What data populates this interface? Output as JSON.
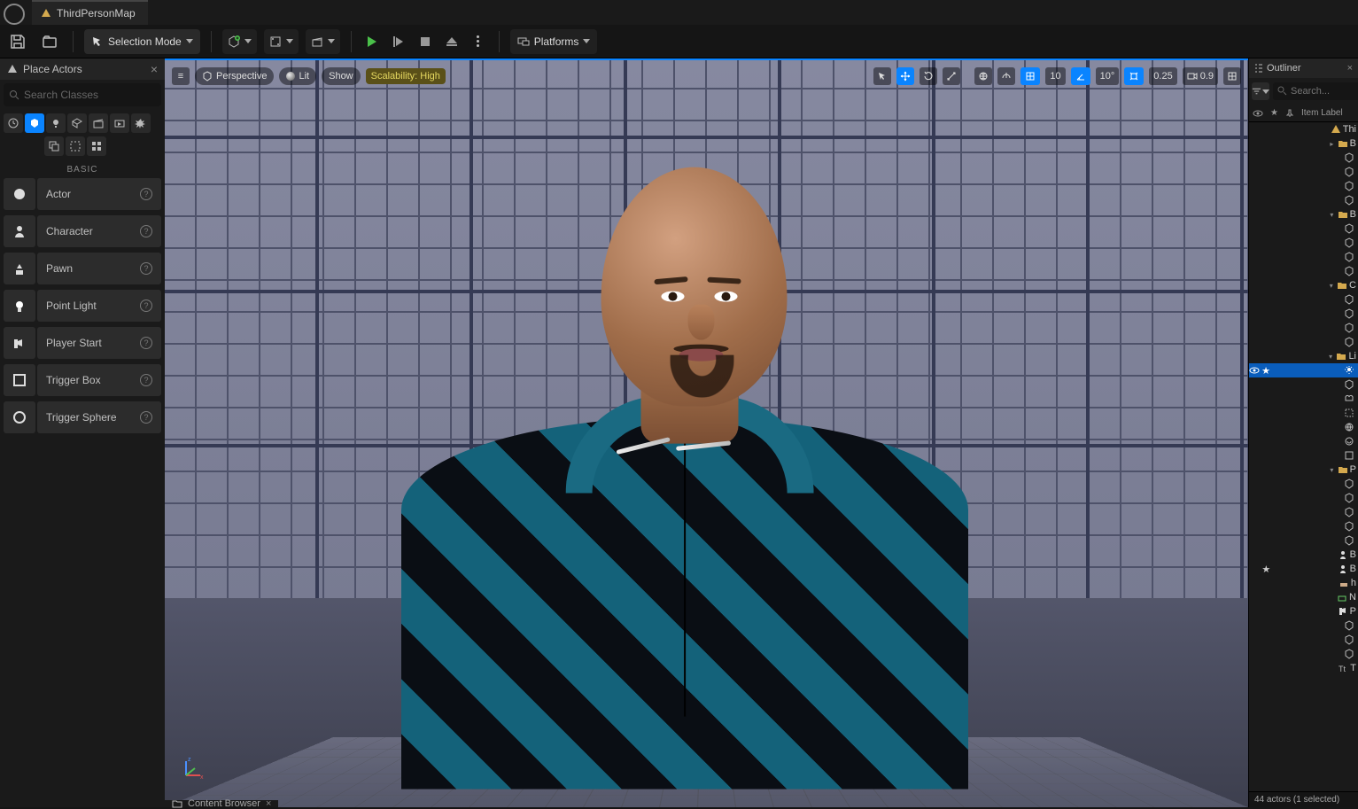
{
  "titlebar": {
    "tab_label": "ThirdPersonMap"
  },
  "toolbar": {
    "selection_mode": "Selection Mode",
    "platforms": "Platforms"
  },
  "left_panel": {
    "title": "Place Actors",
    "search_placeholder": "Search Classes",
    "section": "BASIC",
    "actors": [
      {
        "label": "Actor"
      },
      {
        "label": "Character"
      },
      {
        "label": "Pawn"
      },
      {
        "label": "Point Light"
      },
      {
        "label": "Player Start"
      },
      {
        "label": "Trigger Box"
      },
      {
        "label": "Trigger Sphere"
      }
    ]
  },
  "viewport": {
    "menu": "≡",
    "perspective": "Perspective",
    "lit": "Lit",
    "show": "Show",
    "scalability": "Scalability: High",
    "grid_snap": "10",
    "angle_snap": "10°",
    "scale_snap": "0.25",
    "camera_speed": "0.9"
  },
  "outliner": {
    "title": "Outliner",
    "search_placeholder": "Search...",
    "col_item": "Item Label",
    "status": "44 actors (1 selected)",
    "rows": [
      {
        "indent": 0,
        "icon": "level",
        "label": "Thi",
        "prefix": ""
      },
      {
        "indent": 1,
        "icon": "folder",
        "label": "B",
        "prefix": "▸"
      },
      {
        "indent": 2,
        "icon": "actor",
        "label": "",
        "prefix": ""
      },
      {
        "indent": 2,
        "icon": "actor",
        "label": "",
        "prefix": ""
      },
      {
        "indent": 2,
        "icon": "actor",
        "label": "",
        "prefix": ""
      },
      {
        "indent": 2,
        "icon": "actor",
        "label": "",
        "prefix": ""
      },
      {
        "indent": 1,
        "icon": "folder",
        "label": "B",
        "prefix": "▾"
      },
      {
        "indent": 2,
        "icon": "actor",
        "label": "",
        "prefix": ""
      },
      {
        "indent": 2,
        "icon": "actor",
        "label": "",
        "prefix": ""
      },
      {
        "indent": 2,
        "icon": "actor",
        "label": "",
        "prefix": ""
      },
      {
        "indent": 2,
        "icon": "actor",
        "label": "",
        "prefix": ""
      },
      {
        "indent": 1,
        "icon": "folder",
        "label": "C",
        "prefix": "▾"
      },
      {
        "indent": 2,
        "icon": "actor",
        "label": "",
        "prefix": ""
      },
      {
        "indent": 2,
        "icon": "actor",
        "label": "",
        "prefix": ""
      },
      {
        "indent": 2,
        "icon": "actor",
        "label": "",
        "prefix": ""
      },
      {
        "indent": 2,
        "icon": "actor",
        "label": "",
        "prefix": ""
      },
      {
        "indent": 1,
        "icon": "folder",
        "label": "Li",
        "prefix": "▾"
      },
      {
        "indent": 2,
        "icon": "light",
        "label": "",
        "prefix": "",
        "selected": true
      },
      {
        "indent": 2,
        "icon": "actor",
        "label": "",
        "prefix": ""
      },
      {
        "indent": 2,
        "icon": "fog",
        "label": "",
        "prefix": ""
      },
      {
        "indent": 2,
        "icon": "post",
        "label": "",
        "prefix": ""
      },
      {
        "indent": 2,
        "icon": "sky",
        "label": "",
        "prefix": ""
      },
      {
        "indent": 2,
        "icon": "skyl",
        "label": "",
        "prefix": ""
      },
      {
        "indent": 2,
        "icon": "vol",
        "label": "",
        "prefix": ""
      },
      {
        "indent": 1,
        "icon": "folder",
        "label": "P",
        "prefix": "▾"
      },
      {
        "indent": 2,
        "icon": "actor",
        "label": "",
        "prefix": ""
      },
      {
        "indent": 2,
        "icon": "actor",
        "label": "",
        "prefix": ""
      },
      {
        "indent": 2,
        "icon": "actor",
        "label": "",
        "prefix": ""
      },
      {
        "indent": 2,
        "icon": "actor",
        "label": "",
        "prefix": ""
      },
      {
        "indent": 2,
        "icon": "actor",
        "label": "",
        "prefix": ""
      },
      {
        "indent": 1,
        "icon": "char",
        "label": "B",
        "prefix": ""
      },
      {
        "indent": 1,
        "icon": "char",
        "label": "B",
        "prefix": "",
        "starred": true
      },
      {
        "indent": 1,
        "icon": "mesh",
        "label": "h",
        "prefix": ""
      },
      {
        "indent": 1,
        "icon": "nav",
        "label": "N",
        "prefix": ""
      },
      {
        "indent": 1,
        "icon": "ps",
        "label": "P",
        "prefix": ""
      },
      {
        "indent": 1,
        "icon": "actor",
        "label": "",
        "prefix": ""
      },
      {
        "indent": 1,
        "icon": "actor",
        "label": "",
        "prefix": ""
      },
      {
        "indent": 1,
        "icon": "actor",
        "label": "",
        "prefix": ""
      },
      {
        "indent": 1,
        "icon": "text",
        "label": "T",
        "prefix": ""
      }
    ]
  },
  "content_browser": {
    "title": "Content Browser"
  }
}
